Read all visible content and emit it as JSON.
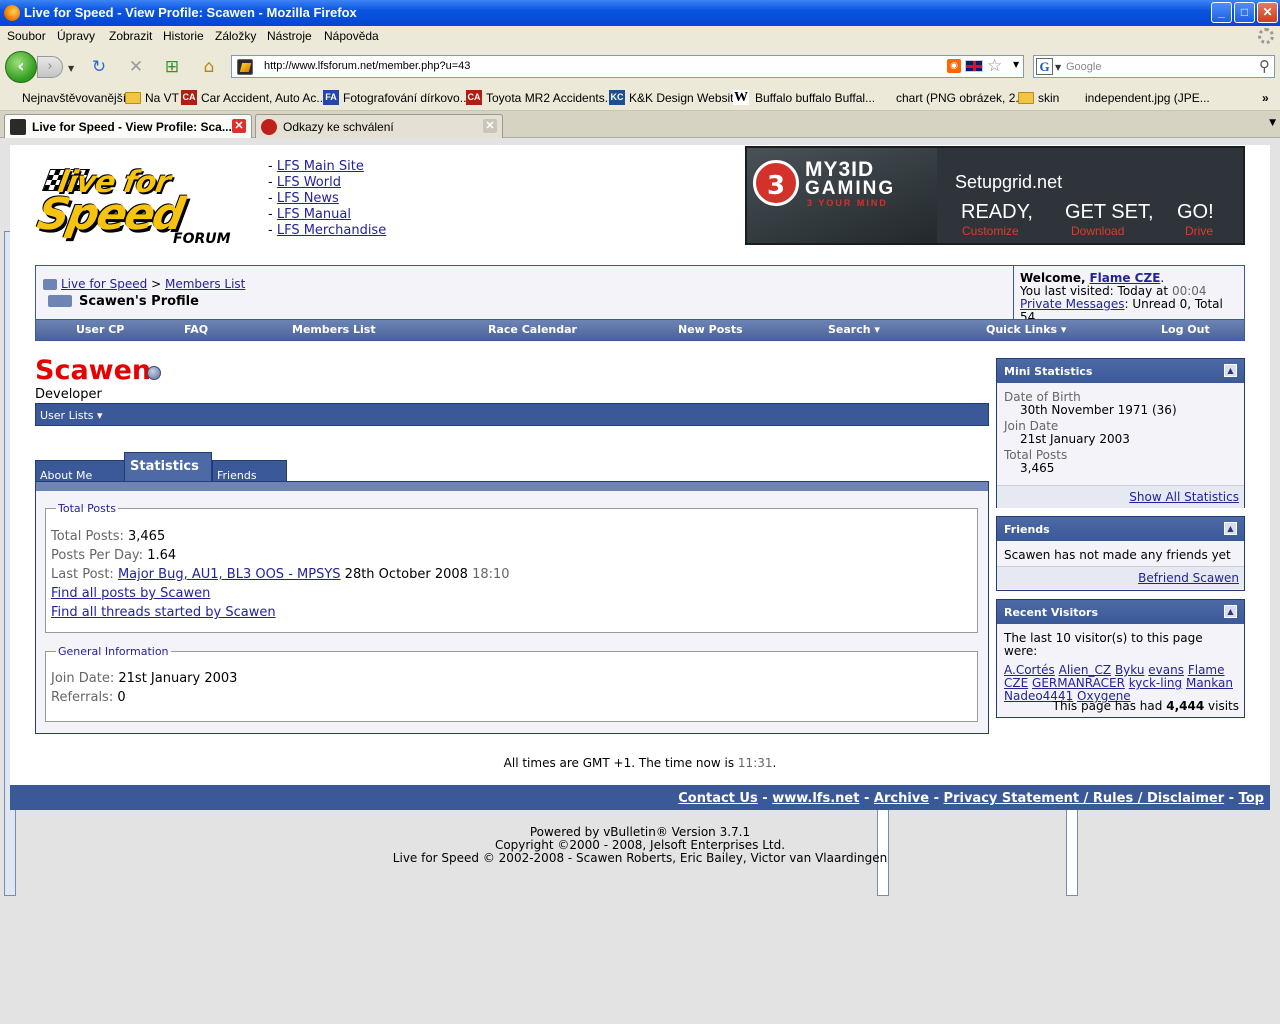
{
  "window": {
    "title": "Live for Speed - View Profile: Scawen - Mozilla Firefox",
    "min": "_",
    "max": "□",
    "close": "✕"
  },
  "menu": [
    "Soubor",
    "Úpravy",
    "Zobrazit",
    "Historie",
    "Záložky",
    "Nástroje",
    "Nápověda"
  ],
  "toolbar": {
    "url": "http://www.lfsforum.net/member.php?u=43",
    "search_placeholder": "Google"
  },
  "bookmarks": [
    {
      "label": "Nejnavštěvovanější",
      "icon": "star-page-icon"
    },
    {
      "label": "Na VT",
      "icon": "folder-icon"
    },
    {
      "label": "Car Accident, Auto Ac...",
      "icon": "ca-icon"
    },
    {
      "label": "Fotografování dírkovo...",
      "icon": "fa-icon"
    },
    {
      "label": "Toyota MR2 Accidents...",
      "icon": "ca-icon"
    },
    {
      "label": "K&K Design Website",
      "icon": "kk-icon"
    },
    {
      "label": "Buffalo buffalo Buffal...",
      "icon": "wikipedia-icon"
    },
    {
      "label": "chart (PNG obrázek, 2...",
      "icon": "page-icon"
    },
    {
      "label": "skin",
      "icon": "folder-icon"
    },
    {
      "label": "independent.jpg (JPE...",
      "icon": "page-icon"
    }
  ],
  "tabs": [
    {
      "label": "Live for Speed - View Profile: Sca...",
      "active": true
    },
    {
      "label": "Odkazy ke schválení",
      "active": false
    }
  ],
  "site": {
    "logo_line1": "live for",
    "logo_line2": "Speed",
    "logo_forum": "FORUM",
    "links": [
      "LFS Main Site",
      "LFS World",
      "LFS News",
      "LFS Manual",
      "LFS Merchandise"
    ],
    "banner": {
      "brand1": "MY3ID",
      "brand2": "GAMING",
      "tagline": "3 YOUR MIND",
      "logo_char": "3",
      "site": "Setupgrid.net",
      "cta": [
        {
          "big": "READY,",
          "small": "Customize"
        },
        {
          "big": "GET SET,",
          "small": "Download"
        },
        {
          "big": "GO!",
          "small": "Drive"
        }
      ]
    }
  },
  "breadcrumb": {
    "root": "Live for Speed",
    "sep": ">",
    "parent": "Members List",
    "current": "Scawen's Profile"
  },
  "welcome": {
    "prefix": "Welcome,",
    "user": "Flame CZE",
    "suffix": ".",
    "last_visit_label": "You last visited: Today at",
    "last_visit_time": "00:04",
    "pm_label": "Private Messages",
    "pm_counts": ": Unread 0, Total 54."
  },
  "nav_menu": [
    "User CP",
    "FAQ",
    "Members List",
    "Race Calendar",
    "New Posts",
    "Search ▾",
    "Quick Links ▾",
    "Log Out"
  ],
  "profile": {
    "username": "Scawen",
    "usertitle": "Developer",
    "user_lists": "User Lists ▾",
    "tabs": [
      "About Me",
      "Statistics",
      "Friends"
    ],
    "total_posts_legend": "Total Posts",
    "total_posts_label": "Total Posts:",
    "total_posts_value": "3,465",
    "ppd_label": "Posts Per Day:",
    "ppd_value": "1.64",
    "last_post_label": "Last Post:",
    "last_post_link": "Major Bug, AU1, BL3 OOS - MPSYS",
    "last_post_date": "28th October 2008",
    "last_post_time": "18:10",
    "find_posts": "Find all posts by Scawen",
    "find_threads": "Find all threads started by Scawen",
    "general_legend": "General Information",
    "join_label": "Join Date:",
    "join_value": "21st January 2003",
    "ref_label": "Referrals:",
    "ref_value": "0"
  },
  "sidebar": {
    "mini": {
      "title": "Mini Statistics",
      "dob_label": "Date of Birth",
      "dob_value": "30th November 1971 (36)",
      "join_label": "Join Date",
      "join_value": "21st January 2003",
      "posts_label": "Total Posts",
      "posts_value": "3,465",
      "show_all": "Show All Statistics"
    },
    "friends": {
      "title": "Friends",
      "text": "Scawen has not made any friends yet",
      "befriend": "Befriend Scawen"
    },
    "visitors": {
      "title": "Recent Visitors",
      "intro": "The last 10 visitor(s) to this page were:",
      "names": [
        "A.Cortés",
        "Alien_CZ",
        "Byku",
        "evans",
        "Flame",
        "CZE",
        "GERMANRACER",
        "kyck-ling",
        "Mankan",
        "Nadeo4441",
        "Oxygene"
      ],
      "visits_prefix": "This page has had",
      "visits_count": "4,444",
      "visits_suffix": "visits"
    }
  },
  "footer": {
    "time_prefix": "All times are GMT +1. The time now is",
    "time_value": "11:31",
    "time_suffix": ".",
    "links": [
      "Contact Us",
      "www.lfs.net",
      "Archive",
      "Privacy Statement / Rules / Disclaimer",
      "Top"
    ],
    "sep": "-",
    "powered": "Powered by vBulletin® Version 3.7.1",
    "copyright": "Copyright ©2000 - 2008, Jelsoft Enterprises Ltd.",
    "lfs_copyright": "Live for Speed © 2002-2008 - Scawen Roberts, Eric Bailey, Victor van Vlaardingen"
  }
}
